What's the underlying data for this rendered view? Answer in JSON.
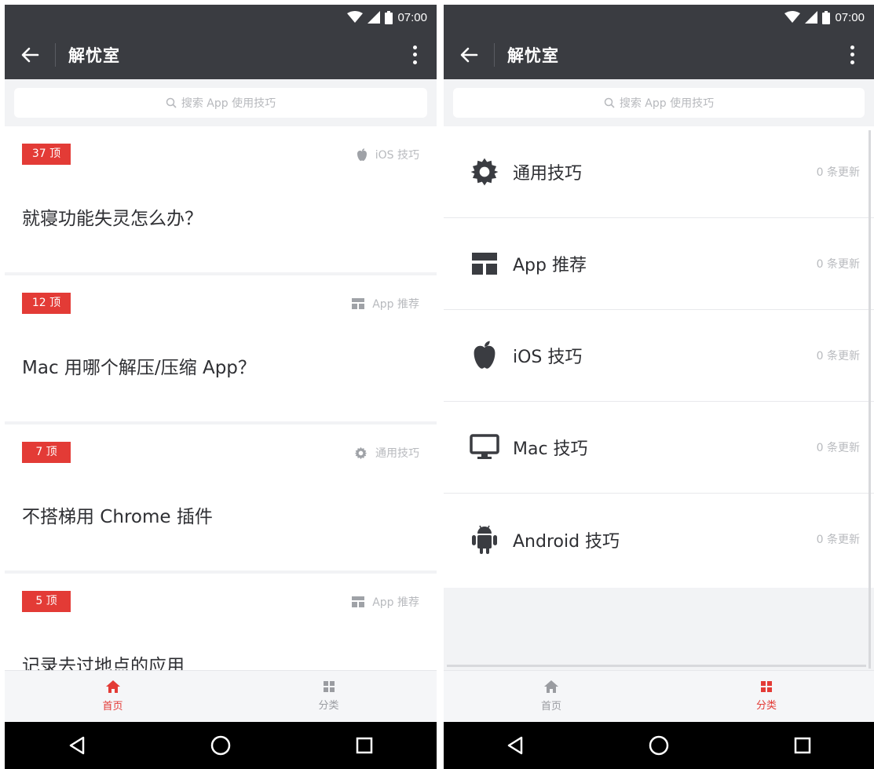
{
  "status": {
    "time": "07:00"
  },
  "app": {
    "title": "解忧室"
  },
  "search": {
    "placeholder": "搜索 App 使用技巧"
  },
  "posts": [
    {
      "badge": "37 顶",
      "category": "iOS 技巧",
      "category_icon": "apple-icon",
      "title": "就寝功能失灵怎么办？"
    },
    {
      "badge": "12 顶",
      "category": "App 推荐",
      "category_icon": "app-grid-icon",
      "title": "Mac 用哪个解压/压缩 App？"
    },
    {
      "badge": "7 顶",
      "category": "通用技巧",
      "category_icon": "gear-icon",
      "title": "不搭梯用 Chrome 插件"
    },
    {
      "badge": "5 顶",
      "category": "App 推荐",
      "category_icon": "app-grid-icon",
      "title": "记录去过地点的应用"
    }
  ],
  "categories": [
    {
      "name": "通用技巧",
      "count": "0 条更新",
      "icon": "gear-icon"
    },
    {
      "name": "App 推荐",
      "count": "0 条更新",
      "icon": "app-grid-icon"
    },
    {
      "name": "iOS 技巧",
      "count": "0 条更新",
      "icon": "apple-icon"
    },
    {
      "name": "Mac 技巧",
      "count": "0 条更新",
      "icon": "monitor-icon"
    },
    {
      "name": "Android 技巧",
      "count": "0 条更新",
      "icon": "android-icon"
    }
  ],
  "tabs": {
    "home": "首页",
    "category": "分类"
  },
  "colors": {
    "accent": "#e33b36",
    "appbar": "#3a3c41",
    "muted": "#b8babe"
  }
}
